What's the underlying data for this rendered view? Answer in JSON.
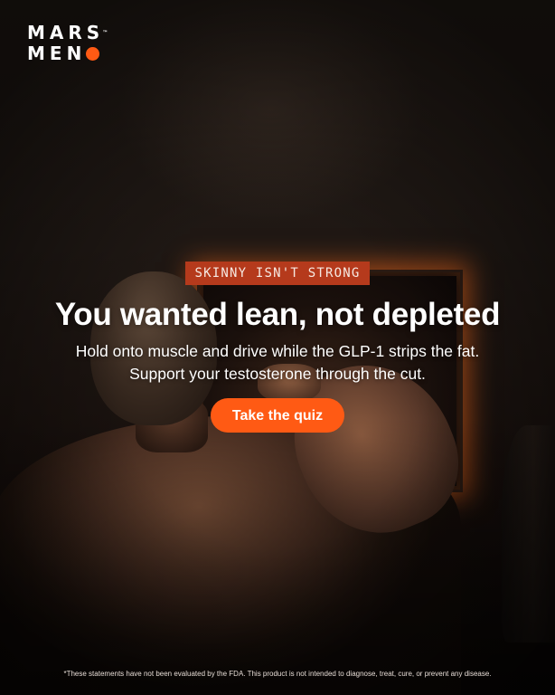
{
  "brand": {
    "logo_line1": "MARS",
    "logo_line2": "MEN",
    "trademark": "™",
    "accent_color": "#ff5a14"
  },
  "hero": {
    "badge": "SKINNY ISN'T STRONG",
    "headline": "You wanted lean, not depleted",
    "subline1": "Hold onto muscle and drive while the GLP-1 strips the fat.",
    "subline2": "Support your testosterone through the cut.",
    "cta_label": "Take the quiz"
  },
  "footer": {
    "disclaimer": "*These statements have not been evaluated by the FDA. This product is not intended to diagnose, treat, cure, or prevent any disease."
  },
  "colors": {
    "badge_bg": "#b53a1c",
    "cta_bg": "#ff5a14",
    "text": "#ffffff"
  }
}
